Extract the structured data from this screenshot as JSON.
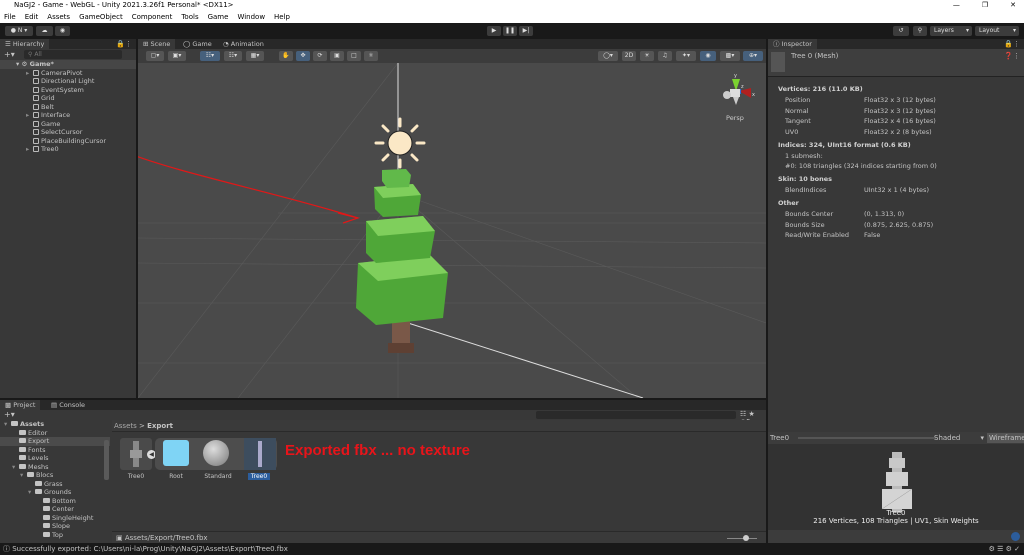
{
  "window": {
    "title": "NaGJ2 - Game - WebGL - Unity 2021.3.26f1 Personal* <DX11>"
  },
  "menu": [
    "File",
    "Edit",
    "Assets",
    "GameObject",
    "Component",
    "Tools",
    "Game",
    "Window",
    "Help"
  ],
  "toolbar": {
    "account": "N",
    "layers": "Layers",
    "layout": "Layout"
  },
  "hierarchy": {
    "tab": "Hierarchy",
    "search_placeholder": "All",
    "root": "Game*",
    "items": [
      "CameraPivot",
      "Directional Light",
      "EventSystem",
      "Grid",
      "Belt",
      "Interface",
      "Game",
      "SelectCursor",
      "PlaceBuildingCursor",
      "Tree0"
    ],
    "expandable": [
      true,
      false,
      false,
      false,
      false,
      true,
      false,
      false,
      false,
      true
    ]
  },
  "scene": {
    "tabs": [
      "Scene",
      "Game",
      "Animation"
    ],
    "mode_2d": "2D",
    "persp": "Persp",
    "gizmo_axes": {
      "y": "y",
      "x": "x",
      "z": "z"
    }
  },
  "inspector": {
    "tab": "Inspector",
    "object": "Tree 0 (Mesh)",
    "vertices_header": "Vertices: 216 (11.0 KB)",
    "vertex_attrs": [
      {
        "k": "Position",
        "v": "Float32 x 3 (12 bytes)"
      },
      {
        "k": "Normal",
        "v": "Float32 x 3 (12 bytes)"
      },
      {
        "k": "Tangent",
        "v": "Float32 x 4 (16 bytes)"
      },
      {
        "k": "UV0",
        "v": "Float32 x 2 (8 bytes)"
      }
    ],
    "indices_header": "Indices: 324, UInt16 format (0.6 KB)",
    "submesh_count": "1 submesh:",
    "submesh0": "#0: 108 triangles (324 indices starting from 0)",
    "skin_header": "Skin: 10 bones",
    "skin_attrs": [
      {
        "k": "BlendIndices",
        "v": "UInt32 x 1 (4 bytes)"
      }
    ],
    "other_header": "Other",
    "other": [
      {
        "k": "Bounds Center",
        "v": "(0, 1.313, 0)"
      },
      {
        "k": "Bounds Size",
        "v": "(0.875, 2.625, 0.875)"
      },
      {
        "k": "Read/Write Enabled",
        "v": "False"
      }
    ]
  },
  "preview": {
    "name": "Tree0",
    "shading": "Shaded",
    "wireframe": "Wireframe",
    "label": "Tree0",
    "info": "216 Vertices, 108 Triangles | UV1, Skin Weights"
  },
  "project": {
    "tabs": [
      "Project",
      "Console"
    ],
    "breadcrumb": [
      "Assets",
      "Export"
    ],
    "tree": [
      {
        "n": "Assets",
        "d": 0,
        "bold": true
      },
      {
        "n": "Editor",
        "d": 1
      },
      {
        "n": "Export",
        "d": 1,
        "sel": true
      },
      {
        "n": "Fonts",
        "d": 1
      },
      {
        "n": "Levels",
        "d": 1
      },
      {
        "n": "Meshs",
        "d": 1
      },
      {
        "n": "Blocs",
        "d": 2
      },
      {
        "n": "Grass",
        "d": 3
      },
      {
        "n": "Grounds",
        "d": 3
      },
      {
        "n": "Bottom",
        "d": 4
      },
      {
        "n": "Center",
        "d": 4
      },
      {
        "n": "SingleHeight",
        "d": 4
      },
      {
        "n": "Slope",
        "d": 4
      },
      {
        "n": "Top",
        "d": 4
      }
    ],
    "assets": [
      "Tree0",
      "Root",
      "Standard",
      "Tree0"
    ],
    "path": "Assets/Export/Tree0.fbx",
    "count": "5"
  },
  "annotation": "Exported fbx ... no texture",
  "status": "Successfully exported: C:\\Users\\ni-la\\Prog\\Unity\\NaGJ2\\Assets\\Export\\Tree0.fbx"
}
